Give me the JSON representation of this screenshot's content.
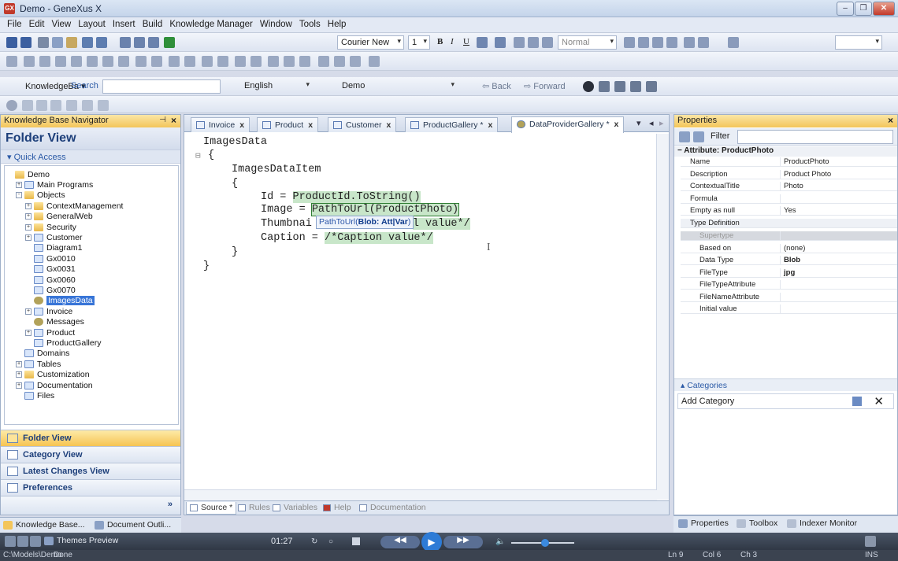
{
  "window": {
    "title": "Demo - GeneXus X"
  },
  "menu": [
    "File",
    "Edit",
    "View",
    "Layout",
    "Insert",
    "Build",
    "Knowledge Manager",
    "Window",
    "Tools",
    "Help"
  ],
  "format_toolbar": {
    "font": "Courier New",
    "size": "1",
    "style": "Normal"
  },
  "search_toolbar": {
    "kb_label": "KnowledgeBa",
    "search_label": "Search",
    "language": "English",
    "environment": "Demo",
    "back": "Back",
    "forward": "Forward"
  },
  "left_panel": {
    "header": "Knowledge Base Navigator",
    "title": "Folder View",
    "quick_access": "Quick Access",
    "tree": [
      {
        "label": "Demo",
        "indent": 0,
        "icon": "folder",
        "exp": ""
      },
      {
        "label": "Main Programs",
        "indent": 1,
        "icon": "obj",
        "exp": "+"
      },
      {
        "label": "Objects",
        "indent": 1,
        "icon": "folder",
        "exp": "-"
      },
      {
        "label": "ContextManagement",
        "indent": 2,
        "icon": "folder",
        "exp": "+"
      },
      {
        "label": "GeneralWeb",
        "indent": 2,
        "icon": "folder",
        "exp": "+"
      },
      {
        "label": "Security",
        "indent": 2,
        "icon": "folder",
        "exp": "+"
      },
      {
        "label": "Customer",
        "indent": 2,
        "icon": "obj",
        "exp": "+"
      },
      {
        "label": "Diagram1",
        "indent": 2,
        "icon": "obj",
        "exp": ""
      },
      {
        "label": "Gx0010",
        "indent": 2,
        "icon": "obj",
        "exp": ""
      },
      {
        "label": "Gx0031",
        "indent": 2,
        "icon": "obj",
        "exp": ""
      },
      {
        "label": "Gx0060",
        "indent": 2,
        "icon": "obj",
        "exp": ""
      },
      {
        "label": "Gx0070",
        "indent": 2,
        "icon": "obj",
        "exp": ""
      },
      {
        "label": "ImagesData",
        "indent": 2,
        "icon": "dp",
        "exp": "",
        "selected": true
      },
      {
        "label": "Invoice",
        "indent": 2,
        "icon": "obj",
        "exp": "+"
      },
      {
        "label": "Messages",
        "indent": 2,
        "icon": "dp",
        "exp": ""
      },
      {
        "label": "Product",
        "indent": 2,
        "icon": "obj",
        "exp": "+"
      },
      {
        "label": "ProductGallery",
        "indent": 2,
        "icon": "obj",
        "exp": ""
      },
      {
        "label": "Domains",
        "indent": 1,
        "icon": "obj",
        "exp": ""
      },
      {
        "label": "Tables",
        "indent": 1,
        "icon": "obj",
        "exp": "+"
      },
      {
        "label": "Customization",
        "indent": 1,
        "icon": "folder",
        "exp": "+"
      },
      {
        "label": "Documentation",
        "indent": 1,
        "icon": "obj",
        "exp": "+"
      },
      {
        "label": "Files",
        "indent": 1,
        "icon": "obj",
        "exp": ""
      }
    ],
    "nav_buttons": [
      "Folder View",
      "Category View",
      "Latest Changes View",
      "Preferences"
    ],
    "bottom_tabs": [
      "Knowledge Base...",
      "Document Outli..."
    ]
  },
  "editor": {
    "tabs": [
      {
        "label": "Invoice",
        "close": "x"
      },
      {
        "label": "Product",
        "close": "x"
      },
      {
        "label": "Customer",
        "close": "x"
      },
      {
        "label": "ProductGallery *",
        "close": "x"
      },
      {
        "label": "DataProviderGallery *",
        "close": "x"
      }
    ],
    "code": {
      "l1": "ImagesData",
      "l2": "{",
      "l3": "ImagesDataItem",
      "l4": "{",
      "l5a": "Id = ",
      "l5b": "ProductId.ToString()",
      "l6a": "Image = ",
      "l6b": "PathToUrl(ProductPhoto)",
      "l7a": "Thumbnai",
      "l7b": "l value*/",
      "l8a": "Caption = ",
      "l8b": "/*Caption value*/",
      "l9": "}",
      "l10": "}"
    },
    "tooltip": {
      "fn": "PathToUrl(",
      "arg": "Blob: Att|Var",
      "end": ")"
    },
    "bottom_tabs": [
      "Source *",
      "Rules",
      "Variables",
      "Help",
      "Documentation"
    ]
  },
  "properties": {
    "header": "Properties",
    "filter": "Filter",
    "section": "Attribute: ProductPhoto",
    "rows": [
      {
        "name": "Name",
        "value": "ProductPhoto"
      },
      {
        "name": "Description",
        "value": "Product Photo"
      },
      {
        "name": "ContextualTitle",
        "value": "Photo"
      },
      {
        "name": "Formula",
        "value": ""
      },
      {
        "name": "Empty as null",
        "value": "Yes"
      }
    ],
    "type_section": "Type Definition",
    "type_rows": [
      {
        "name": "Supertype",
        "value": ""
      },
      {
        "name": "Based on",
        "value": "(none)"
      },
      {
        "name": "Data Type",
        "value": "Blob"
      },
      {
        "name": "FileType",
        "value": "jpg"
      },
      {
        "name": "FileTypeAttribute",
        "value": ""
      },
      {
        "name": "FileNameAttribute",
        "value": ""
      },
      {
        "name": "Initial value",
        "value": ""
      }
    ],
    "categories": "Categories",
    "add_category": "Add Category",
    "bottom_tabs": [
      "Properties",
      "Toolbox",
      "Indexer Monitor"
    ]
  },
  "taskbar": {
    "themes": "Themes Preview",
    "time": "01:27"
  },
  "status": {
    "path": "C:\\Models\\Demo",
    "state": "Done",
    "ln": "Ln 9",
    "col": "Col 6",
    "ch": "Ch 3",
    "ins": "INS"
  }
}
